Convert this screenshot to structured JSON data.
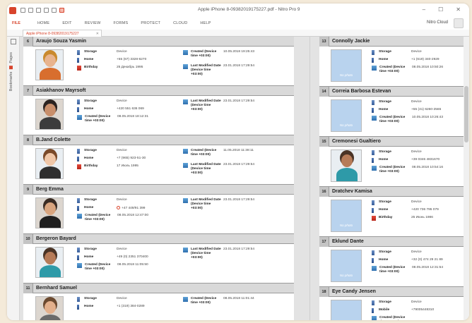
{
  "window": {
    "title": "Apple iPhone 8-09382019175227.pdf - Nitro Pro 9",
    "minimize": "–",
    "maximize": "☐",
    "close": "✕",
    "cloud_label": "Nitro Cloud"
  },
  "menu": {
    "file": "FILE",
    "items": [
      "HOME",
      "EDIT",
      "REVIEW",
      "FORMS",
      "PROTECT",
      "CLOUD",
      "HELP"
    ]
  },
  "tab": {
    "label": "Apple iPhone 8-09382019175227",
    "close": "✕"
  },
  "sidebar": {
    "bookmarks": "Bookmarks",
    "pages": "Pages"
  },
  "labels": {
    "storage": "Storage",
    "home": "Home",
    "birthday": "Birthday",
    "created": "Created (Device time +03:00)",
    "modified": "Last Modified Date (Device time +03:00)",
    "mobile": "Mobile",
    "device": "Device",
    "no_photo": "No photo"
  },
  "left_records": [
    {
      "num": "6",
      "name": "Araujo Souza Yasmin",
      "storage": "Device",
      "home": "+55 (67) 3328-6270",
      "third_label": "Birthday",
      "third": "25 Декабрь 1995",
      "created": "10.05.2018 19:25:43",
      "modified": "23.01.2018 17:29:54"
    },
    {
      "num": "7",
      "name": "Asiakhanov Mayrsoft",
      "storage": "Device",
      "home": "+420 551 636 069",
      "third_label": "Created",
      "third": "08.05.2018 18:12:31",
      "created": "",
      "modified": "23.01.2018 17:29:54"
    },
    {
      "num": "8",
      "name": "B.Jand Colette",
      "storage": "Device",
      "home": "+7 (965) 923-51-30",
      "third_label": "Birthday",
      "third": "17 Июль 1995",
      "created": "11.05.2018 11:38:11",
      "modified": "23.01.2018 17:29:54"
    },
    {
      "num": "9",
      "name": "Berg Emma",
      "storage": "Device",
      "home": "+47 449/91 399",
      "third_label": "Created",
      "third": "08.05.2018 12:47:00",
      "created": "",
      "modified": "23.01.2018 17:29:54"
    },
    {
      "num": "10",
      "name": "Bergeron Bayard",
      "storage": "Device",
      "home": "+49 (0) 2351 370400",
      "third_label": "Created",
      "third": "08.05.2018 11:05:50",
      "created": "",
      "modified": "23.01.2018 17:29:54"
    },
    {
      "num": "11",
      "name": "Bernhard Samuel",
      "storage": "Device",
      "home": "+1 (319) 384-0289",
      "third_label": "",
      "third": "",
      "created": "08.05.2018 11:01:44",
      "modified": ""
    }
  ],
  "right_records": [
    {
      "num": "13",
      "name": "Connolly Jackie",
      "storage": "Device",
      "home": "+1 (619) 340-2929",
      "third_label": "Created",
      "third": "08.05.2018 10:50:26"
    },
    {
      "num": "14",
      "name": "Correia Barbosa Estevan",
      "storage": "Device",
      "home": "+55 (41) 6260-2565",
      "third_label": "Created",
      "third": "10.05.2018 10:26:43"
    },
    {
      "num": "15",
      "name": "Cremonesi Gualtiero",
      "storage": "Device",
      "home": "+39 0346 4831670",
      "third_label": "Created",
      "third": "08.05.2018 10:54:16"
    },
    {
      "num": "16",
      "name": "Dratchev Kamisa",
      "storage": "Device",
      "home": "+420 736 795 079",
      "third_label": "Birthday",
      "third": "25 Июнь 1986"
    },
    {
      "num": "17",
      "name": "Eklund Dante",
      "storage": "Device",
      "home": "+32 (0) 474 29 21 89",
      "third_label": "Created",
      "third": "08.05.2018 12:31:54"
    },
    {
      "num": "18",
      "name": "Eye Candy Jensen",
      "storage": "Device",
      "home": "+79005448310",
      "third_label": "Created",
      "third": ""
    }
  ]
}
